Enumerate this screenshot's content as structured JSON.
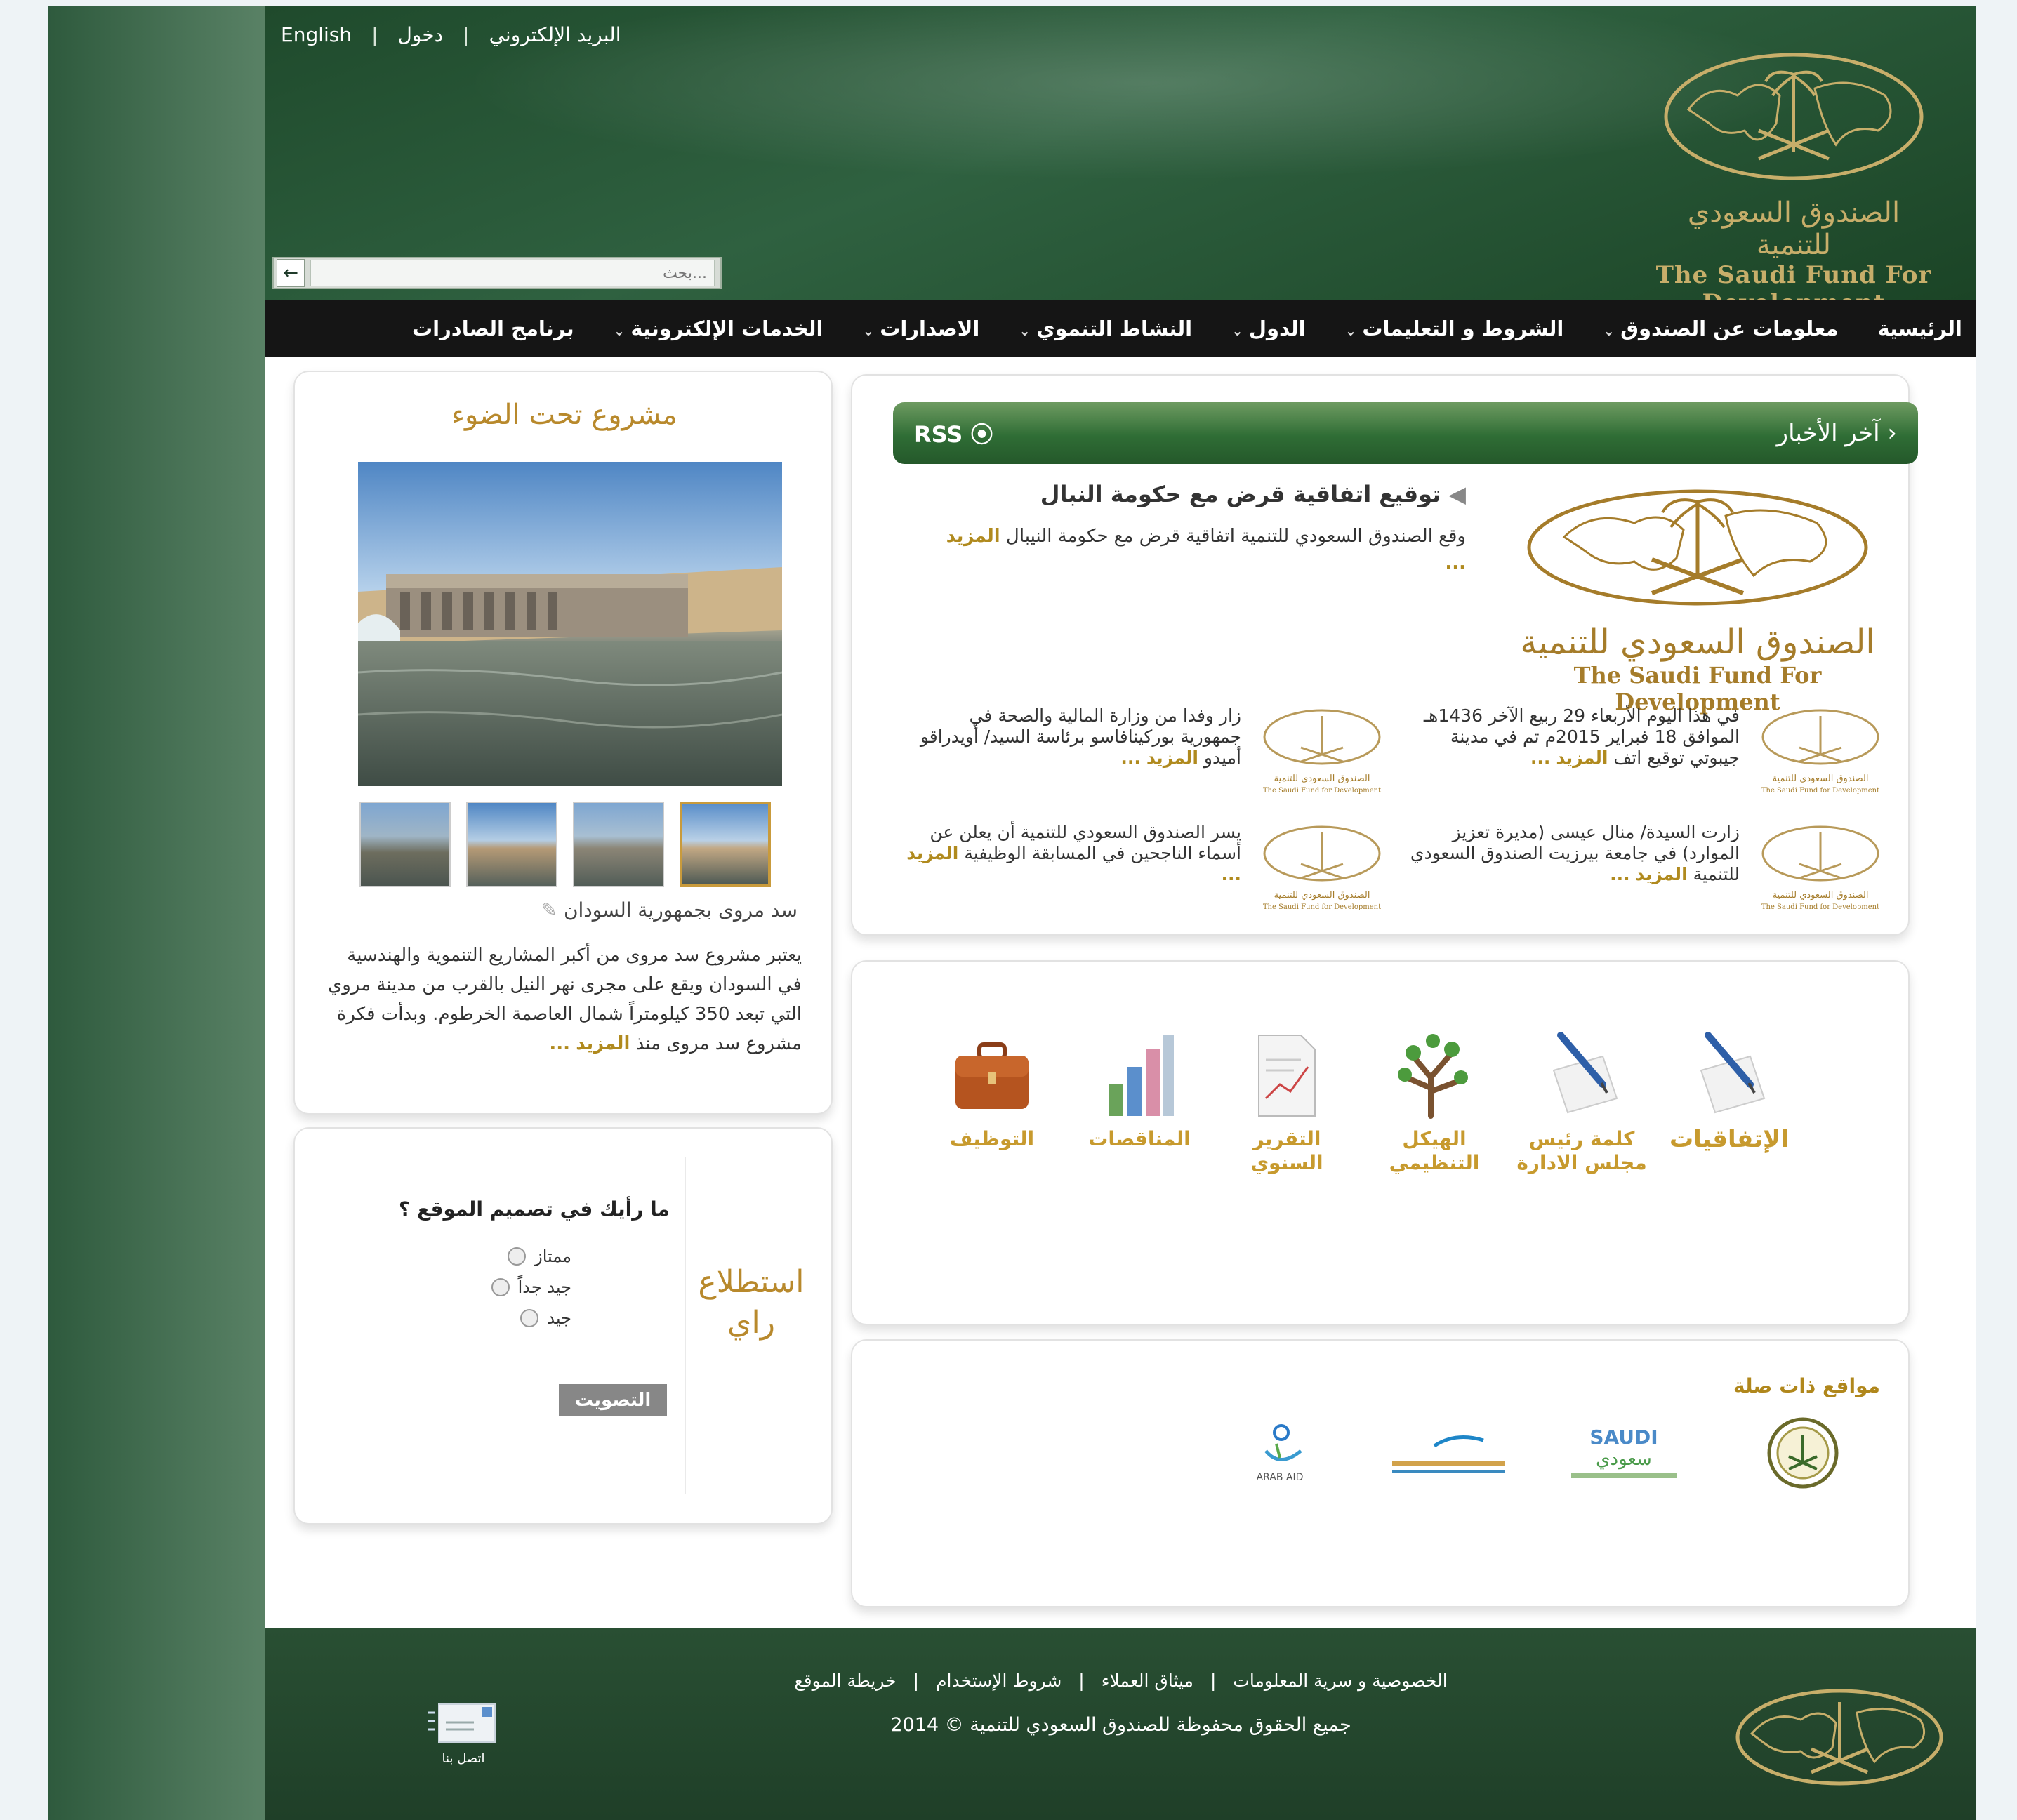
{
  "top_links": {
    "english": "English",
    "login": "دخول",
    "email": "البريد الإلكتروني",
    "separator": "|"
  },
  "search": {
    "placeholder": "بحث..."
  },
  "logo": {
    "arabic": "الصندوق السعودي للتنمية",
    "english": "The Saudi Fund For Development"
  },
  "nav": {
    "items": [
      {
        "label": "الرئيسية",
        "has_menu": false
      },
      {
        "label": "معلومات عن الصندوق",
        "has_menu": true
      },
      {
        "label": "الشروط و التعليمات",
        "has_menu": true
      },
      {
        "label": "الدول",
        "has_menu": true
      },
      {
        "label": "النشاط التنموي",
        "has_menu": true
      },
      {
        "label": "الاصدارات",
        "has_menu": true
      },
      {
        "label": "الخدمات الإلكترونية",
        "has_menu": true
      },
      {
        "label": "برنامج الصادرات",
        "has_menu": false
      }
    ],
    "chevron": "⌄"
  },
  "news": {
    "title": "آخر الأخبار",
    "rss": "RSS",
    "main": {
      "headline": "توقيع اتفاقية قرض مع حكومة النبال",
      "summary": "وقع الصندوق السعودي للتنمية اتفاقية قرض مع حكومة النيبال",
      "more": "المزيد",
      "ellipsis": "..."
    },
    "items": [
      {
        "text": "في هذا اليوم الأربعاء 29 ربيع الآخر 1436هـ الموافق 18 فبراير 2015م تم في مدينة جيبوتي توقيع اتف",
        "more": "المزيد",
        "ellipsis": "..."
      },
      {
        "text": "زار وفدا من وزارة المالية والصحة في جمهورية بوركينافاسو برئاسة السيد/ أويدراقو أميدو",
        "more": "المزيد",
        "ellipsis": "..."
      },
      {
        "text": "زارت السيدة/ منال عيسى (مديرة تعزيز الموارد) في جامعة بيرزيت الصندوق السعودي للتنمية",
        "more": "المزيد",
        "ellipsis": "..."
      },
      {
        "text": "يسر الصندوق السعودي للتنمية أن يعلن عن أسماء الناجحين في المسابقة الوظيفية",
        "more": "المزيد",
        "ellipsis": "..."
      }
    ],
    "thumb_logo_ar": "الصندوق السعودي للتنمية",
    "thumb_logo_en": "The Saudi Fund for Development"
  },
  "quick_links": [
    {
      "label": "الإتفاقيات",
      "icon": "pen-paper-icon"
    },
    {
      "label": "كلمة رئيس مجلس الادارة",
      "icon": "pen-paper-icon"
    },
    {
      "label": "الهيكل التنظيمي",
      "icon": "org-tree-icon"
    },
    {
      "label": "التقرير السنوي",
      "icon": "report-doc-icon"
    },
    {
      "label": "المناقصات",
      "icon": "bar-chart-icon"
    },
    {
      "label": "التوظيف",
      "icon": "briefcase-icon"
    }
  ],
  "related": {
    "title": "مواقع ذات صلة",
    "saudi_text": "SAUDI",
    "saudi_ar": "سعودي",
    "arab_aid": "ARAB AID"
  },
  "spotlight": {
    "title": "مشروع تحت الضوء",
    "caption": "سد مروى بجمهورية السودان",
    "text": "يعتبر مشروع سد مروى من أكبر المشاريع التنموية والهندسية في السودان ويقع على مجرى نهر النيل بالقرب من مدينة مروي التي تبعد 350 كيلومتراً شمال العاصمة الخرطوم. وبدأت فكرة مشروع سد مروى منذ",
    "more": "المزيد",
    "ellipsis": "..."
  },
  "poll": {
    "label": "استطلاع راي",
    "question": "ما رأيك في تصميم الموقع ؟",
    "options": [
      "ممتاز",
      "جيد جداً",
      "جيد"
    ],
    "vote": "التصويت"
  },
  "footer": {
    "links": [
      "الخصوصية و سرية المعلومات",
      "ميثاق العملاء",
      "شروط الإستخدام",
      "خريطة الموقع"
    ],
    "separator": "|",
    "copyright": "جميع الحقوق محفوظة للصندوق السعودي للتنمية © 2014",
    "contact": "اتصل بنا"
  },
  "colors": {
    "header_green": "#2f6140",
    "nav_bg": "#151515",
    "gold": "#b8892c",
    "footer_green": "#294f33"
  }
}
